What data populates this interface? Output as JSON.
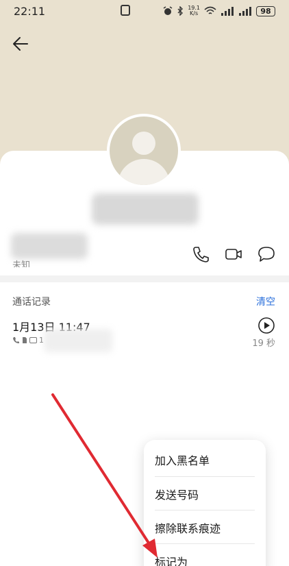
{
  "status_bar": {
    "time": "22:11",
    "net_speed_value": "19.1",
    "net_speed_unit": "K/s",
    "battery": "98"
  },
  "contact": {
    "unknown_label": "未知"
  },
  "call_log": {
    "title": "通话记录",
    "clear_label": "清空",
    "entries": [
      {
        "date_time": "1月13日 11:47",
        "meta_prefix": "1",
        "duration": "19 秒"
      }
    ]
  },
  "menu": {
    "items": [
      {
        "label": "加入黑名单"
      },
      {
        "label": "发送号码"
      },
      {
        "label": "擦除联系痕迹"
      },
      {
        "label": "标记为"
      }
    ]
  },
  "colors": {
    "header_bg": "#e9e1cf",
    "accent_link": "#2a6fdb",
    "annotation_arrow": "#e02a32"
  },
  "icons": [
    "back-arrow-icon",
    "phone-icon",
    "video-call-icon",
    "message-icon",
    "play-icon",
    "alarm-icon",
    "bluetooth-icon",
    "wifi-icon",
    "signal-icon",
    "battery-icon",
    "nfc-icon"
  ]
}
